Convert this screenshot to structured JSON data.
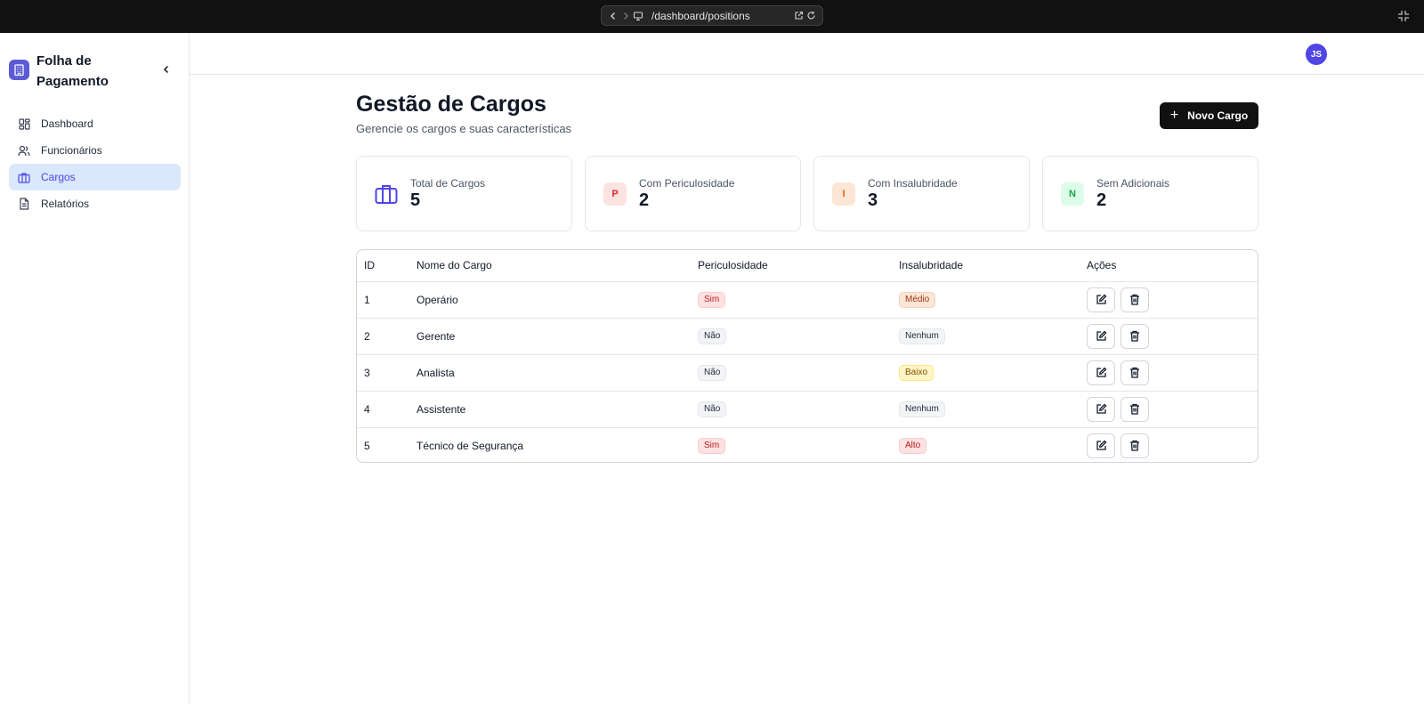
{
  "browser": {
    "url": "/dashboard/positions"
  },
  "sidebar": {
    "brand_title": "Folha de Pagamento",
    "items": [
      {
        "label": "Dashboard",
        "icon": "grid-icon",
        "active": false
      },
      {
        "label": "Funcionários",
        "icon": "users-icon",
        "active": false
      },
      {
        "label": "Cargos",
        "icon": "briefcase-icon",
        "active": true
      },
      {
        "label": "Relatórios",
        "icon": "file-text-icon",
        "active": false
      }
    ]
  },
  "header": {
    "avatar_initials": "JS"
  },
  "main": {
    "title": "Gestão de Cargos",
    "subtitle": "Gerencie os cargos e suas características",
    "new_button_label": "Novo Cargo",
    "stats": [
      {
        "label": "Total de Cargos",
        "value": "5",
        "icon": "briefcase-icon"
      },
      {
        "label": "Com Periculosidade",
        "value": "2",
        "icon_letter": "P"
      },
      {
        "label": "Com Insalubridade",
        "value": "3",
        "icon_letter": "I"
      },
      {
        "label": "Sem Adicionais",
        "value": "2",
        "icon_letter": "N"
      }
    ],
    "table": {
      "headers": [
        "ID",
        "Nome do Cargo",
        "Periculosidade",
        "Insalubridade",
        "Ações"
      ],
      "rows": [
        {
          "id": "1",
          "name": "Operário",
          "periculosidade": "Sim",
          "insalubridade": "Médio"
        },
        {
          "id": "2",
          "name": "Gerente",
          "periculosidade": "Não",
          "insalubridade": "Nenhum"
        },
        {
          "id": "3",
          "name": "Analista",
          "periculosidade": "Não",
          "insalubridade": "Baixo"
        },
        {
          "id": "4",
          "name": "Assistente",
          "periculosidade": "Não",
          "insalubridade": "Nenhum"
        },
        {
          "id": "5",
          "name": "Técnico de Segurança",
          "periculosidade": "Sim",
          "insalubridade": "Alto"
        }
      ]
    }
  },
  "colors": {
    "accent": "#4f46e5",
    "active_nav_bg": "#dbe7fb",
    "danger_badge_bg": "#fde2e2",
    "warning_badge_bg": "#fde6d6",
    "low_badge_bg": "#fef6c2",
    "neutral_badge_bg": "#f3f4f6",
    "success_icon_bg": "#dcfce7"
  }
}
